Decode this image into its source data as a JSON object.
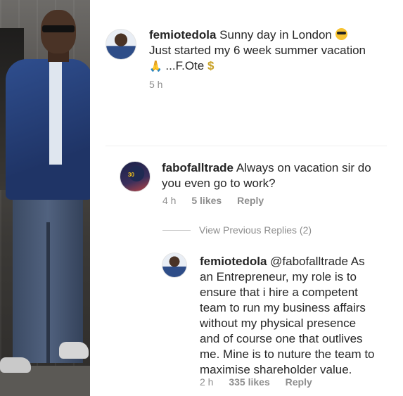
{
  "post": {
    "username": "femiotedola",
    "caption_line1": "Sunny day in London",
    "caption_line2": "Just started my 6 week summer vacation",
    "caption_line3": "...F.Ote",
    "time": "5 h"
  },
  "comment1": {
    "username": "fabofalltrade",
    "text_line1": "Always on vacation sir do",
    "text_line2": "you even go to work?",
    "time": "4 h",
    "likes": "5 likes",
    "reply": "Reply"
  },
  "view_previous": "View Previous Replies (2)",
  "reply1": {
    "username": "femiotedola",
    "mention": "@fabofalltrade",
    "line1_tail": "As",
    "line2": "an Entrepreneur, my role is to",
    "line3": "ensure that i hire a competent",
    "line4": "team to run my business affairs",
    "line5": "without my physical presence",
    "line6": "and of course one that outlives",
    "line7": "me. Mine is to nuture the team to",
    "line8": "maximise shareholder value.",
    "time": "2 h",
    "likes": "335 likes",
    "reply": "Reply"
  },
  "icons": {
    "sunglasses_emoji": "sunglasses-emoji",
    "praying_hands_emoji": "praying-hands-emoji",
    "dollar_emoji": "dollar-emoji"
  }
}
